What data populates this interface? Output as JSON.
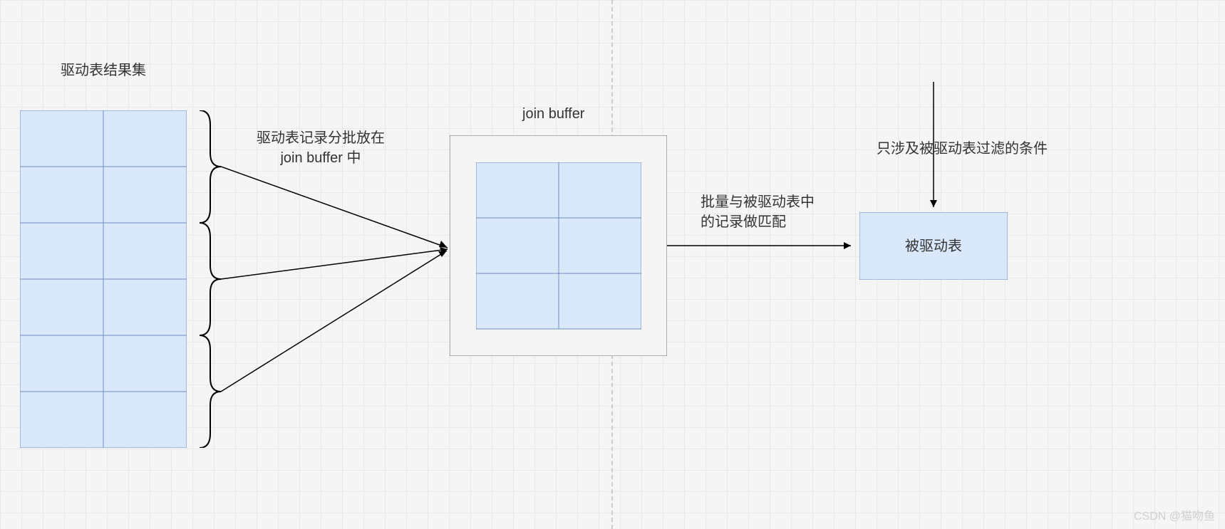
{
  "labels": {
    "driver_title": "驱动表结果集",
    "brace_label_line1": "驱动表记录分批放在",
    "brace_label_line2": "join buffer 中",
    "join_buffer_title": "join buffer",
    "match_label_line1": "批量与被驱动表中",
    "match_label_line2": "的记录做匹配",
    "filter_label": "只涉及被驱动表过滤的条件",
    "driven_table": "被驱动表",
    "watermark": "CSDN @猫吻鱼"
  }
}
